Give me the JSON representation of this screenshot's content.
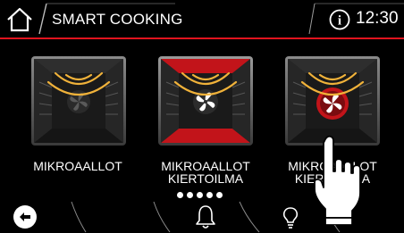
{
  "header": {
    "title": "SMART COOKING",
    "time": "12:30",
    "home_icon": "home-icon",
    "info_icon": "info-icon",
    "accent_color": "#e0141e"
  },
  "tiles": [
    {
      "label_line1": "MIKROAALLOT",
      "label_line2": "",
      "icon": "microwave-icon",
      "selected": false
    },
    {
      "label_line1": "MIKROAALLOT",
      "label_line2": "KIERTOILMA",
      "icon": "microwave-fan-icon",
      "selected": true
    },
    {
      "label_line1": "MIKROAALLOT",
      "label_line2": "KIERTOILMA",
      "icon": "microwave-fan-grill-icon",
      "selected": false
    }
  ],
  "pager": {
    "count": 5,
    "active": 1
  },
  "bottom_bar": {
    "back_icon": "back-icon",
    "bell_icon": "bell-icon",
    "bulb_icon": "lightbulb-icon"
  },
  "overlay": {
    "icon": "pointing-hand-icon"
  }
}
